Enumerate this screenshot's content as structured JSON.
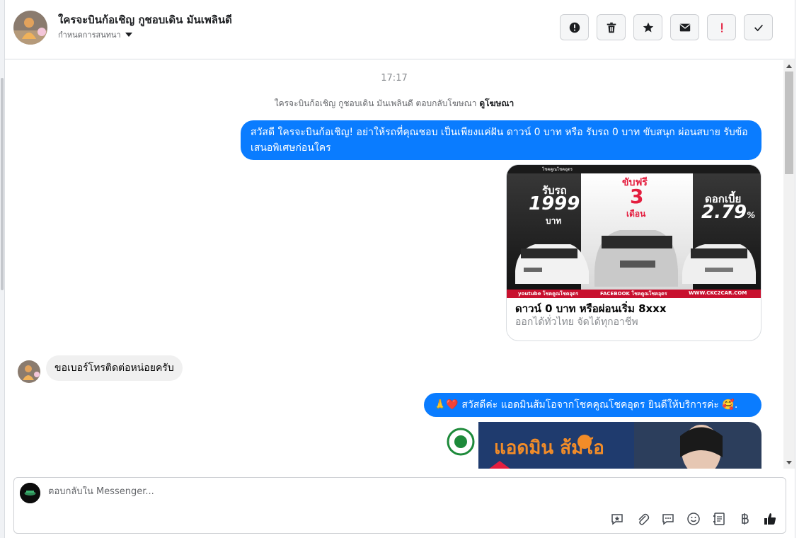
{
  "header": {
    "title": "ใครจะบินก้อเชิญ กูชอบเดิน มันเพลินดี",
    "subtitle": "กำหนดการสนทนา",
    "actions": [
      {
        "name": "report-button",
        "icon": "exclamation-circle-icon"
      },
      {
        "name": "delete-button",
        "icon": "trash-icon"
      },
      {
        "name": "star-button",
        "icon": "star-icon"
      },
      {
        "name": "mark-unread-button",
        "icon": "envelope-icon"
      },
      {
        "name": "spam-button",
        "icon": "exclamation-icon"
      },
      {
        "name": "done-button",
        "icon": "check-icon"
      }
    ]
  },
  "messages": {
    "timestamp": "17:17",
    "ad_note_prefix": "ใครจะบินก้อเชิญ กูชอบเดิน มันเพลินดี ตอบกลับโฆษณา",
    "ad_note_link": "ดูโฆษณา",
    "outgoing_1": "สวัสดี ใครจะบินก้อเชิญ! อย่าให้รถที่คุณชอบ เป็นเพียงแค่ฝัน ดาวน์ 0 บาท หรือ รับรถ 0 บาท ขับสนุก ผ่อนสบาย รับข้อเสนอพิเศษก่อนใคร",
    "ad_card": {
      "image": {
        "left_label": "รับรถ",
        "left_value": "1999",
        "left_unit": "บาท",
        "center_label": "ขับฟรี",
        "center_value": "3",
        "center_unit": "เดือน",
        "right_label": "ดอกเบี้ย",
        "right_value": "2.79",
        "right_unit": "%",
        "footer_1": "youtube โชคคูณโชคอุดร",
        "footer_2": "FACEBOOK โชคคูณโชคอุดร",
        "footer_3": "WWW.CKC2CAR.COM",
        "brand_top": "โชคคูณโชคอุดร"
      },
      "title": "ดาวน์ 0 บาท หรือผ่อนเริ่ม 8xxx",
      "subtitle": "ออกได้ทั่วไทย จัดได้ทุกอาชีพ"
    },
    "incoming_1": "ขอเบอร์โทรติดต่อหน่อยครับ",
    "outgoing_2": "🙏❤️ สวัสดีค่ะ แอดมินส้มโอจากโชคคูณโชคอุดร ยินดีให้บริการค่ะ 🥰.",
    "photo2_text": "แอดมิน ส้มโอ"
  },
  "composer": {
    "placeholder": "ตอบกลับใน Messenger...",
    "tools": [
      "add-reaction-icon",
      "attachment-icon",
      "saved-replies-icon",
      "emoji-icon",
      "notes-icon",
      "baht-icon",
      "like-icon"
    ]
  },
  "colors": {
    "accent": "#0a7cff",
    "danger": "#e41e3f",
    "incoming_bg": "#f0f0f0"
  }
}
